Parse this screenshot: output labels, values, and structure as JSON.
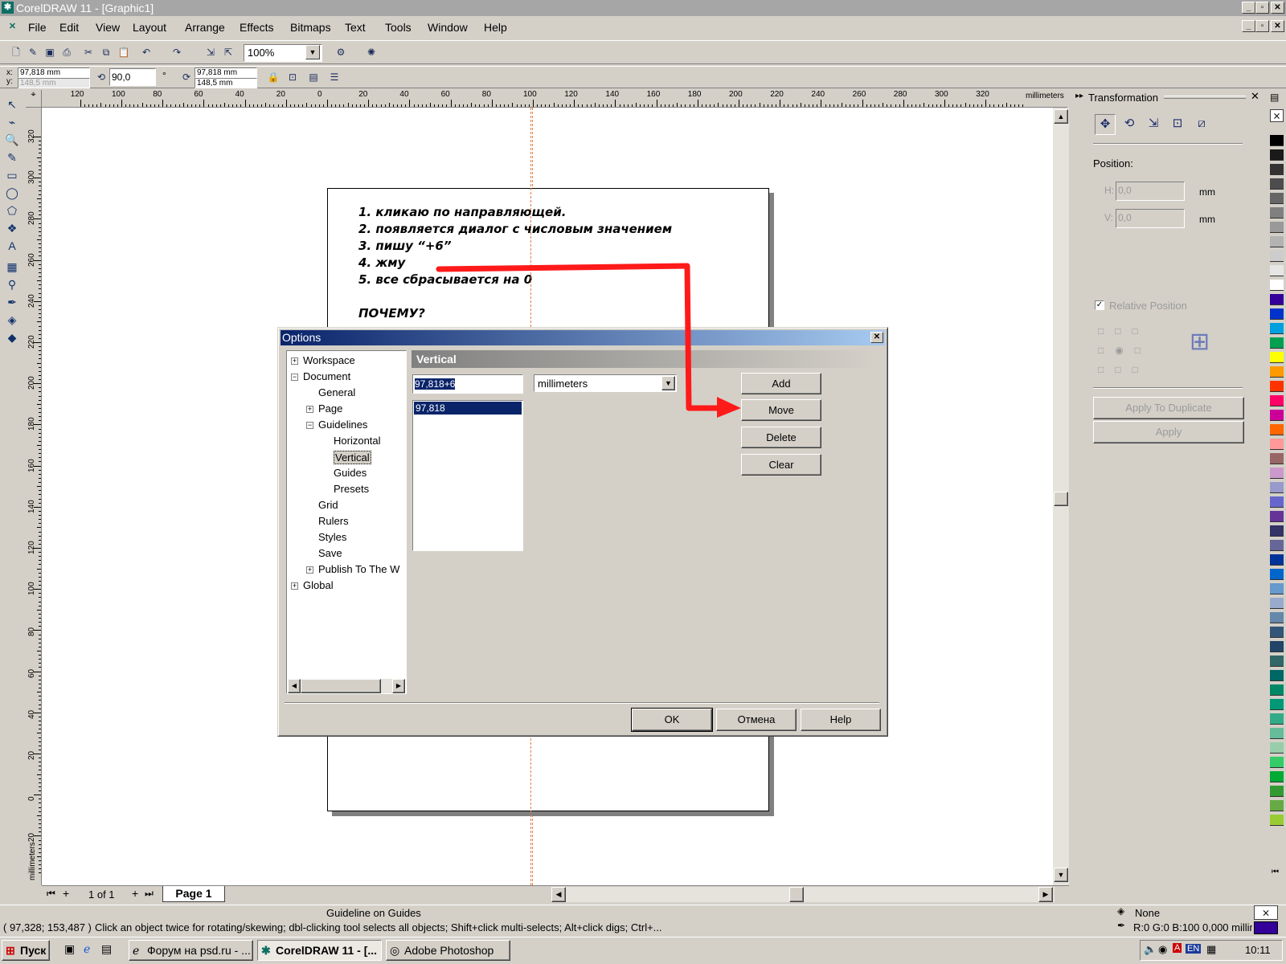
{
  "window": {
    "title": "CorelDRAW 11 - [Graphic1]"
  },
  "menu": [
    "File",
    "Edit",
    "View",
    "Layout",
    "Arrange",
    "Effects",
    "Bitmaps",
    "Text",
    "Tools",
    "Window",
    "Help"
  ],
  "toolbar": {
    "zoom": "100%"
  },
  "propbar": {
    "x": "97,818 mm",
    "y": "148,5 mm",
    "angle": "90,0",
    "deg": "°",
    "w": "97,818 mm",
    "h": "148,5 mm"
  },
  "ruler": {
    "units": "millimeters",
    "h_ticks": [
      "120",
      "100",
      "80",
      "60",
      "40",
      "20",
      "0",
      "20",
      "40",
      "60",
      "80",
      "100",
      "120",
      "140",
      "160",
      "180",
      "200",
      "220",
      "240",
      "260",
      "280",
      "300",
      "320"
    ],
    "v_ticks": [
      "320",
      "300",
      "280",
      "260",
      "240",
      "220",
      "200",
      "180",
      "160",
      "140",
      "120",
      "100",
      "80",
      "60",
      "40",
      "20",
      "0",
      "20"
    ]
  },
  "note": {
    "lines": [
      "1. кликаю по направляющей.",
      "2. появляется диалог с числовым значением",
      "3. пишу “+6”",
      "4. жму",
      "5. все сбрасывается на 0"
    ],
    "question": "ПОЧЕМУ?"
  },
  "dialog": {
    "title": "Options",
    "tree": [
      {
        "label": "Workspace",
        "exp": "+"
      },
      {
        "label": "Document",
        "exp": "−"
      },
      {
        "label": "General"
      },
      {
        "label": "Page",
        "exp": "+"
      },
      {
        "label": "Guidelines",
        "exp": "−"
      },
      {
        "label": "Horizontal"
      },
      {
        "label": "Vertical"
      },
      {
        "label": "Guides"
      },
      {
        "label": "Presets"
      },
      {
        "label": "Grid"
      },
      {
        "label": "Rulers"
      },
      {
        "label": "Styles"
      },
      {
        "label": "Save"
      },
      {
        "label": "Publish To The W",
        "exp": "+"
      },
      {
        "label": "Global",
        "exp": "+"
      }
    ],
    "section": "Vertical",
    "value_input": "97,818+6",
    "units": "millimeters",
    "list_items": [
      "97,818"
    ],
    "buttons": {
      "add": "Add",
      "move": "Move",
      "delete": "Delete",
      "clear": "Clear",
      "ok": "OK",
      "cancel": "Отмена",
      "help": "Help"
    }
  },
  "docker": {
    "title": "Transformation",
    "position_label": "Position:",
    "h_label": "H:",
    "h_value": "0,0",
    "v_label": "V:",
    "v_value": "0,0",
    "unit": "mm",
    "relative": "Relative Position",
    "apply_dup": "Apply To Duplicate",
    "apply": "Apply"
  },
  "pagenav": {
    "count": "1 of 1",
    "tab": "Page 1"
  },
  "status": {
    "hint": "Guideline on Guides",
    "coords": "( 97,328; 153,487 )",
    "message": "Click an object twice for rotating/skewing; dbl-clicking tool selects all objects; Shift+click multi-selects; Alt+click digs; Ctrl+...",
    "fill": "None",
    "outline": "R:0 G:0 B:100  0,000 millim"
  },
  "taskbar": {
    "start": "Пуск",
    "tasks": [
      "Форум на psd.ru - ...",
      "CorelDRAW 11 - [...",
      "Adobe Photoshop"
    ],
    "clock": "10:11"
  },
  "colors": {
    "accent": "#0a246a",
    "arrow": "#ff1a1a",
    "palette": [
      "#000000",
      "#1a1a1a",
      "#333333",
      "#4d4d4d",
      "#666666",
      "#808080",
      "#999999",
      "#b3b3b3",
      "#cccccc",
      "#e6e6e6",
      "#ffffff",
      "#330099",
      "#0033cc",
      "#00a0e0",
      "#00a050",
      "#ffff00",
      "#ff9900",
      "#ff3300",
      "#ff0066",
      "#cc0099",
      "#ff6600",
      "#ff9999",
      "#996666",
      "#cc99cc",
      "#9999cc",
      "#6666cc",
      "#663399",
      "#333366",
      "#666699",
      "#003399",
      "#0066cc",
      "#6699cc",
      "#99aacc",
      "#6688aa",
      "#335577",
      "#224466",
      "#336666",
      "#006666",
      "#008866",
      "#009977",
      "#33aa88",
      "#66bb99",
      "#99ccaa",
      "#33cc66",
      "#00aa33",
      "#339933",
      "#66aa44",
      "#99cc33"
    ]
  }
}
